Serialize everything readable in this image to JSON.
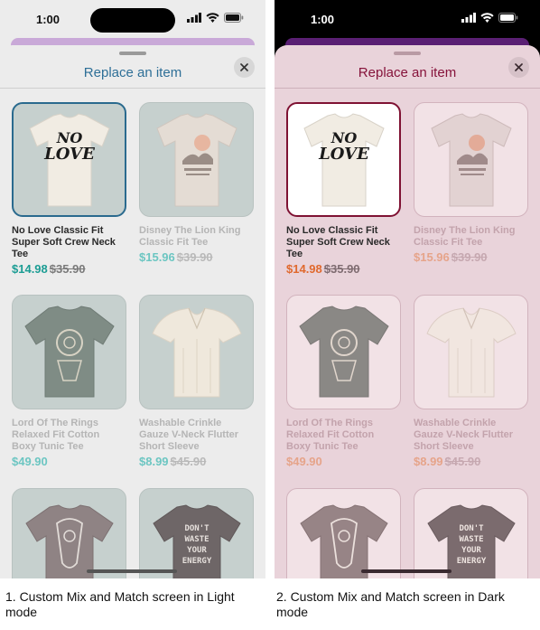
{
  "status": {
    "time": "1:00"
  },
  "sheet": {
    "title": "Replace an item"
  },
  "products": [
    {
      "name": "No Love Classic Fit Super Soft Crew Neck Tee",
      "price": "$14.98",
      "was": "$35.90",
      "tee_text": [
        "NO",
        "LOVE"
      ]
    },
    {
      "name": "Disney The Lion King Classic Fit Tee",
      "price": "$15.96",
      "was": "$39.90"
    },
    {
      "name": "Lord Of The Rings Relaxed Fit Cotton Boxy Tunic Tee",
      "price": "$49.90",
      "was": ""
    },
    {
      "name": "Washable Crinkle Gauze V-Neck Flutter Short Sleeve",
      "price": "$8.99",
      "was": "$45.90"
    },
    {
      "name": "",
      "price": "",
      "was": ""
    },
    {
      "name": "",
      "price": "",
      "was": "",
      "tee_text": [
        "DON'T",
        "WASTE",
        "YOUR",
        "ENERGY"
      ]
    }
  ],
  "captions": {
    "light": "1. Custom Mix and Match screen in Light mode",
    "dark": "2. Custom Mix and Match screen in Dark mode"
  },
  "icons": [
    "wifi-icon",
    "battery-icon",
    "signal-icon",
    "close-icon"
  ],
  "colors": {
    "light_title": "#2e6f97",
    "light_price": "#1c9d94",
    "dark_title": "#86133b",
    "dark_price": "#e0692e",
    "dark_sheet_bg": "#e9d3da"
  }
}
